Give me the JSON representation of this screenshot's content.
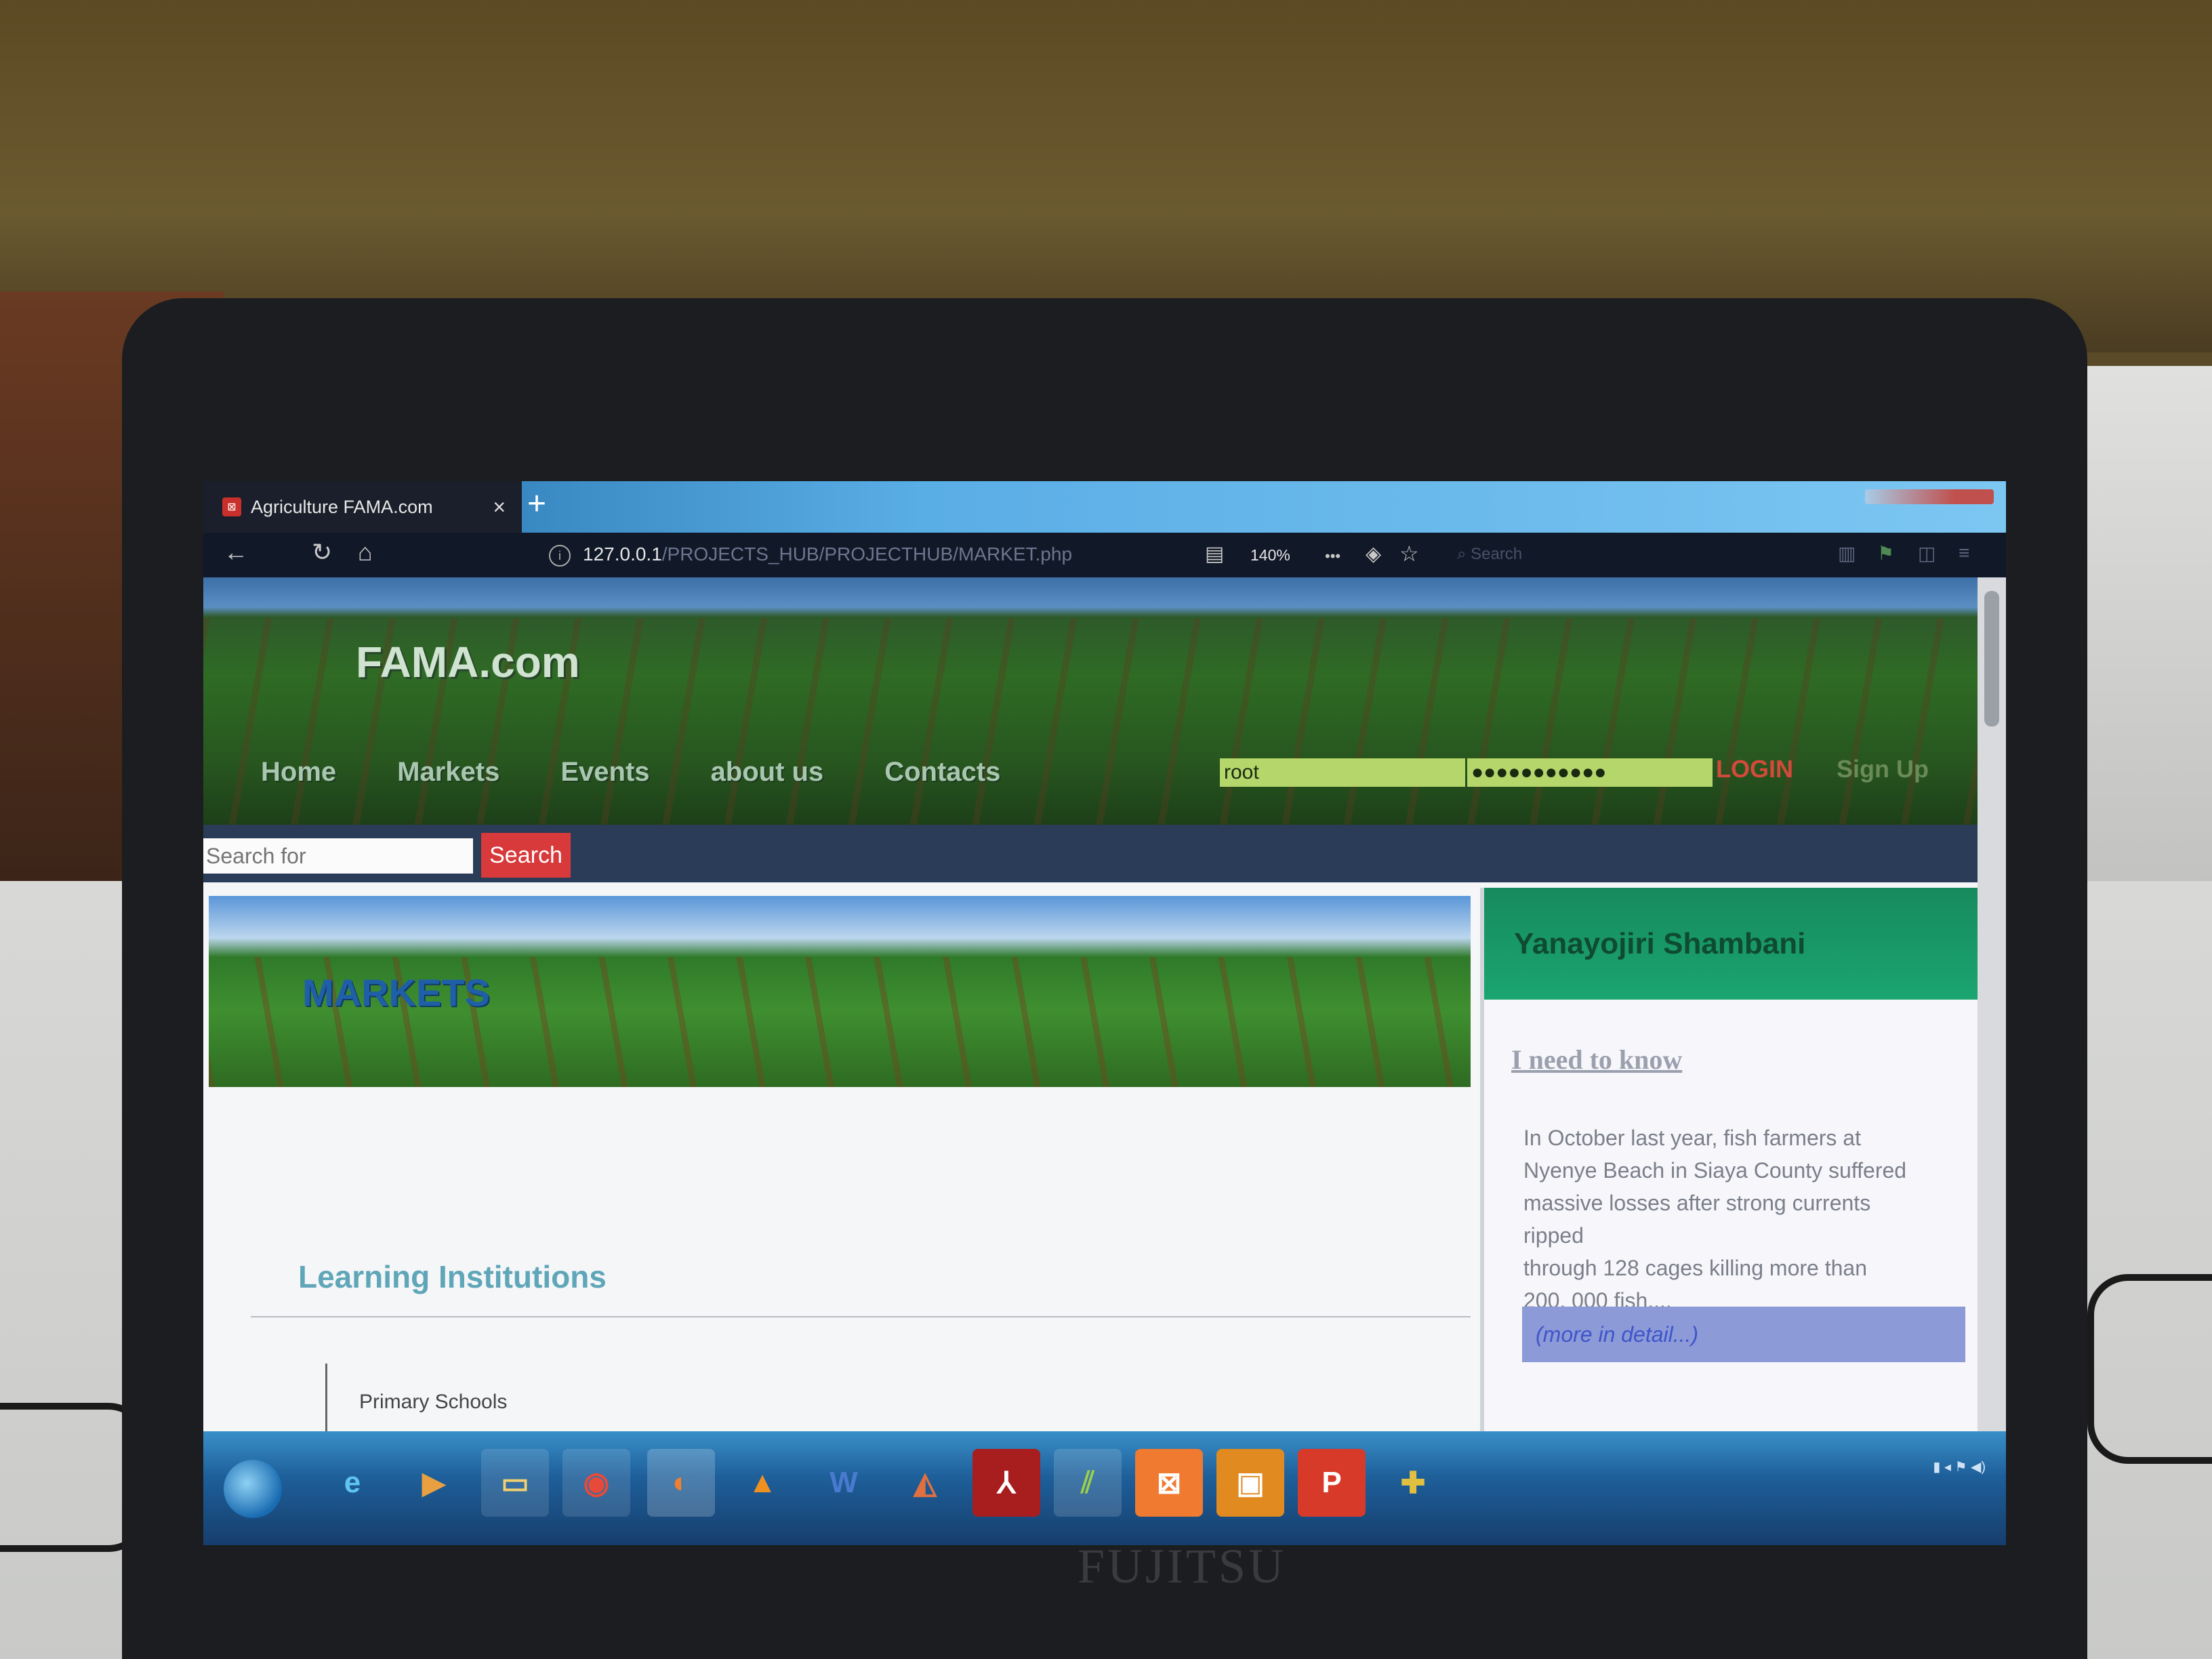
{
  "browser": {
    "tab_title": "Agriculture FAMA.com",
    "tab_close": "×",
    "new_tab": "+",
    "url_host": "127.0.0.1",
    "url_path": "/PROJECTS_HUB/PROJECTHUB/MARKET.php",
    "zoom": "140%",
    "toolbar_search_placeholder": "Search",
    "overflow": "•••"
  },
  "site": {
    "logo": "FAMA.com",
    "nav": [
      "Home",
      "Markets",
      "Events",
      "about us",
      "Contacts"
    ],
    "login_user_value": "root",
    "login_pass_value": "●●●●●●●●●●●",
    "login_label": "LOGIN",
    "signup_label": "Sign Up",
    "search_placeholder": "Search for",
    "search_button": "Search"
  },
  "banner": {
    "title": "MARKETS"
  },
  "main": {
    "section_title": "Learning Institutions",
    "first_item": "Primary Schools"
  },
  "sidebar": {
    "header": "Yanayojiri Shambani",
    "link": "I need to know",
    "text": "In October last year, fish farmers at\nNyenye Beach in Siaya County suffered\nmassive losses after strong currents\nripped\nthrough 128 cages killing more than\n200, 000 fish....",
    "more": "(more in detail...)"
  },
  "device": {
    "brand": "FUJITSU"
  },
  "colors": {
    "accent_red": "#d8393a",
    "sidebar_header": "#1aa570",
    "nav_strip": "#2a3c58"
  }
}
